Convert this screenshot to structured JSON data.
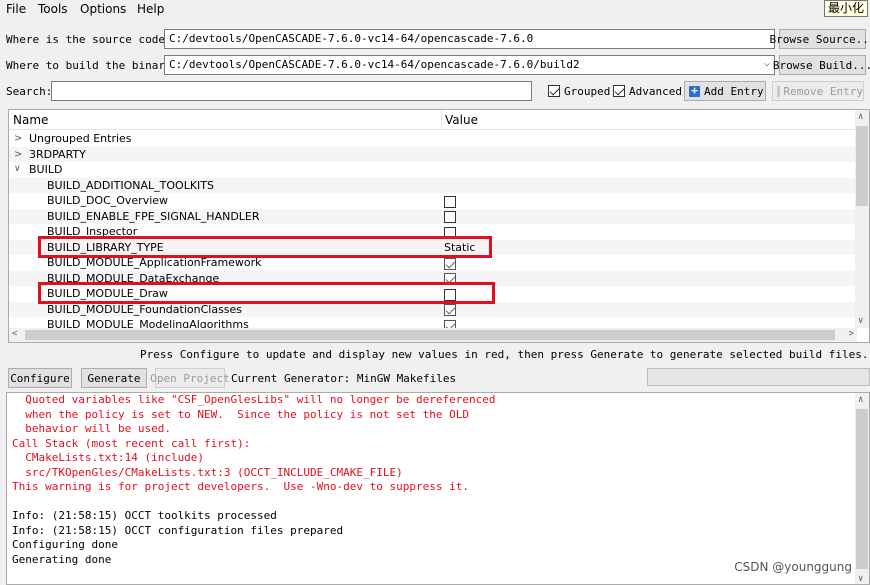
{
  "menu": {
    "file": "File",
    "tools": "Tools",
    "options": "Options",
    "help": "Help"
  },
  "tooltip": "最小化",
  "source": {
    "label": "Where is the source code:",
    "value": "C:/devtools/OpenCASCADE-7.6.0-vc14-64/opencascade-7.6.0",
    "button": "Browse Source..."
  },
  "build": {
    "label": "Where to build the binaries:",
    "value": "C:/devtools/OpenCASCADE-7.6.0-vc14-64/opencascade-7.6.0/build2",
    "button": "Browse Build..."
  },
  "search": {
    "label": "Search:",
    "value": ""
  },
  "options": {
    "grouped": "Grouped",
    "advanced": "Advanced",
    "add_entry": "Add Entry",
    "remove_entry": "Remove Entry"
  },
  "tree": {
    "header_name": "Name",
    "header_value": "Value",
    "rows": [
      {
        "name": "Ungrouped Entries"
      },
      {
        "name": "3RDPARTY"
      },
      {
        "name": "BUILD"
      },
      {
        "name": "BUILD_ADDITIONAL_TOOLKITS",
        "value": ""
      },
      {
        "name": "BUILD_DOC_Overview"
      },
      {
        "name": "BUILD_ENABLE_FPE_SIGNAL_HANDLER"
      },
      {
        "name": "BUILD_Inspector"
      },
      {
        "name": "BUILD_LIBRARY_TYPE",
        "value": "Static"
      },
      {
        "name": "BUILD_MODULE_ApplicationFramework"
      },
      {
        "name": "BUILD_MODULE_DataExchange"
      },
      {
        "name": "BUILD_MODULE_Draw"
      },
      {
        "name": "BUILD_MODULE_FoundationClasses"
      },
      {
        "name": "BUILD_MODULE_ModelingAlgorithms"
      }
    ]
  },
  "hint": "Press Configure to update and display new values in red, then press Generate to generate selected build files.",
  "actions": {
    "configure": "Configure",
    "generate": "Generate",
    "open_project": "Open Project",
    "generator": "Current Generator: MinGW Makefiles"
  },
  "output": [
    "  Quoted variables like \"CSF_OpenGlesLibs\" will no longer be dereferenced",
    "  when the policy is set to NEW.  Since the policy is not set the OLD",
    "  behavior will be used.",
    "Call Stack (most recent call first):",
    "  CMakeLists.txt:14 (include)",
    "  src/TKOpenGles/CMakeLists.txt:3 (OCCT_INCLUDE_CMAKE_FILE)",
    "This warning is for project developers.  Use -Wno-dev to suppress it.",
    "",
    "Info: (21:58:15) OCCT toolkits processed",
    "Info: (21:58:15) OCCT configuration files prepared",
    "Configuring done",
    "Generating done"
  ],
  "watermark": "CSDN @younggung",
  "colors": {
    "error_text": "#e01020",
    "highlight": "#e01020"
  }
}
